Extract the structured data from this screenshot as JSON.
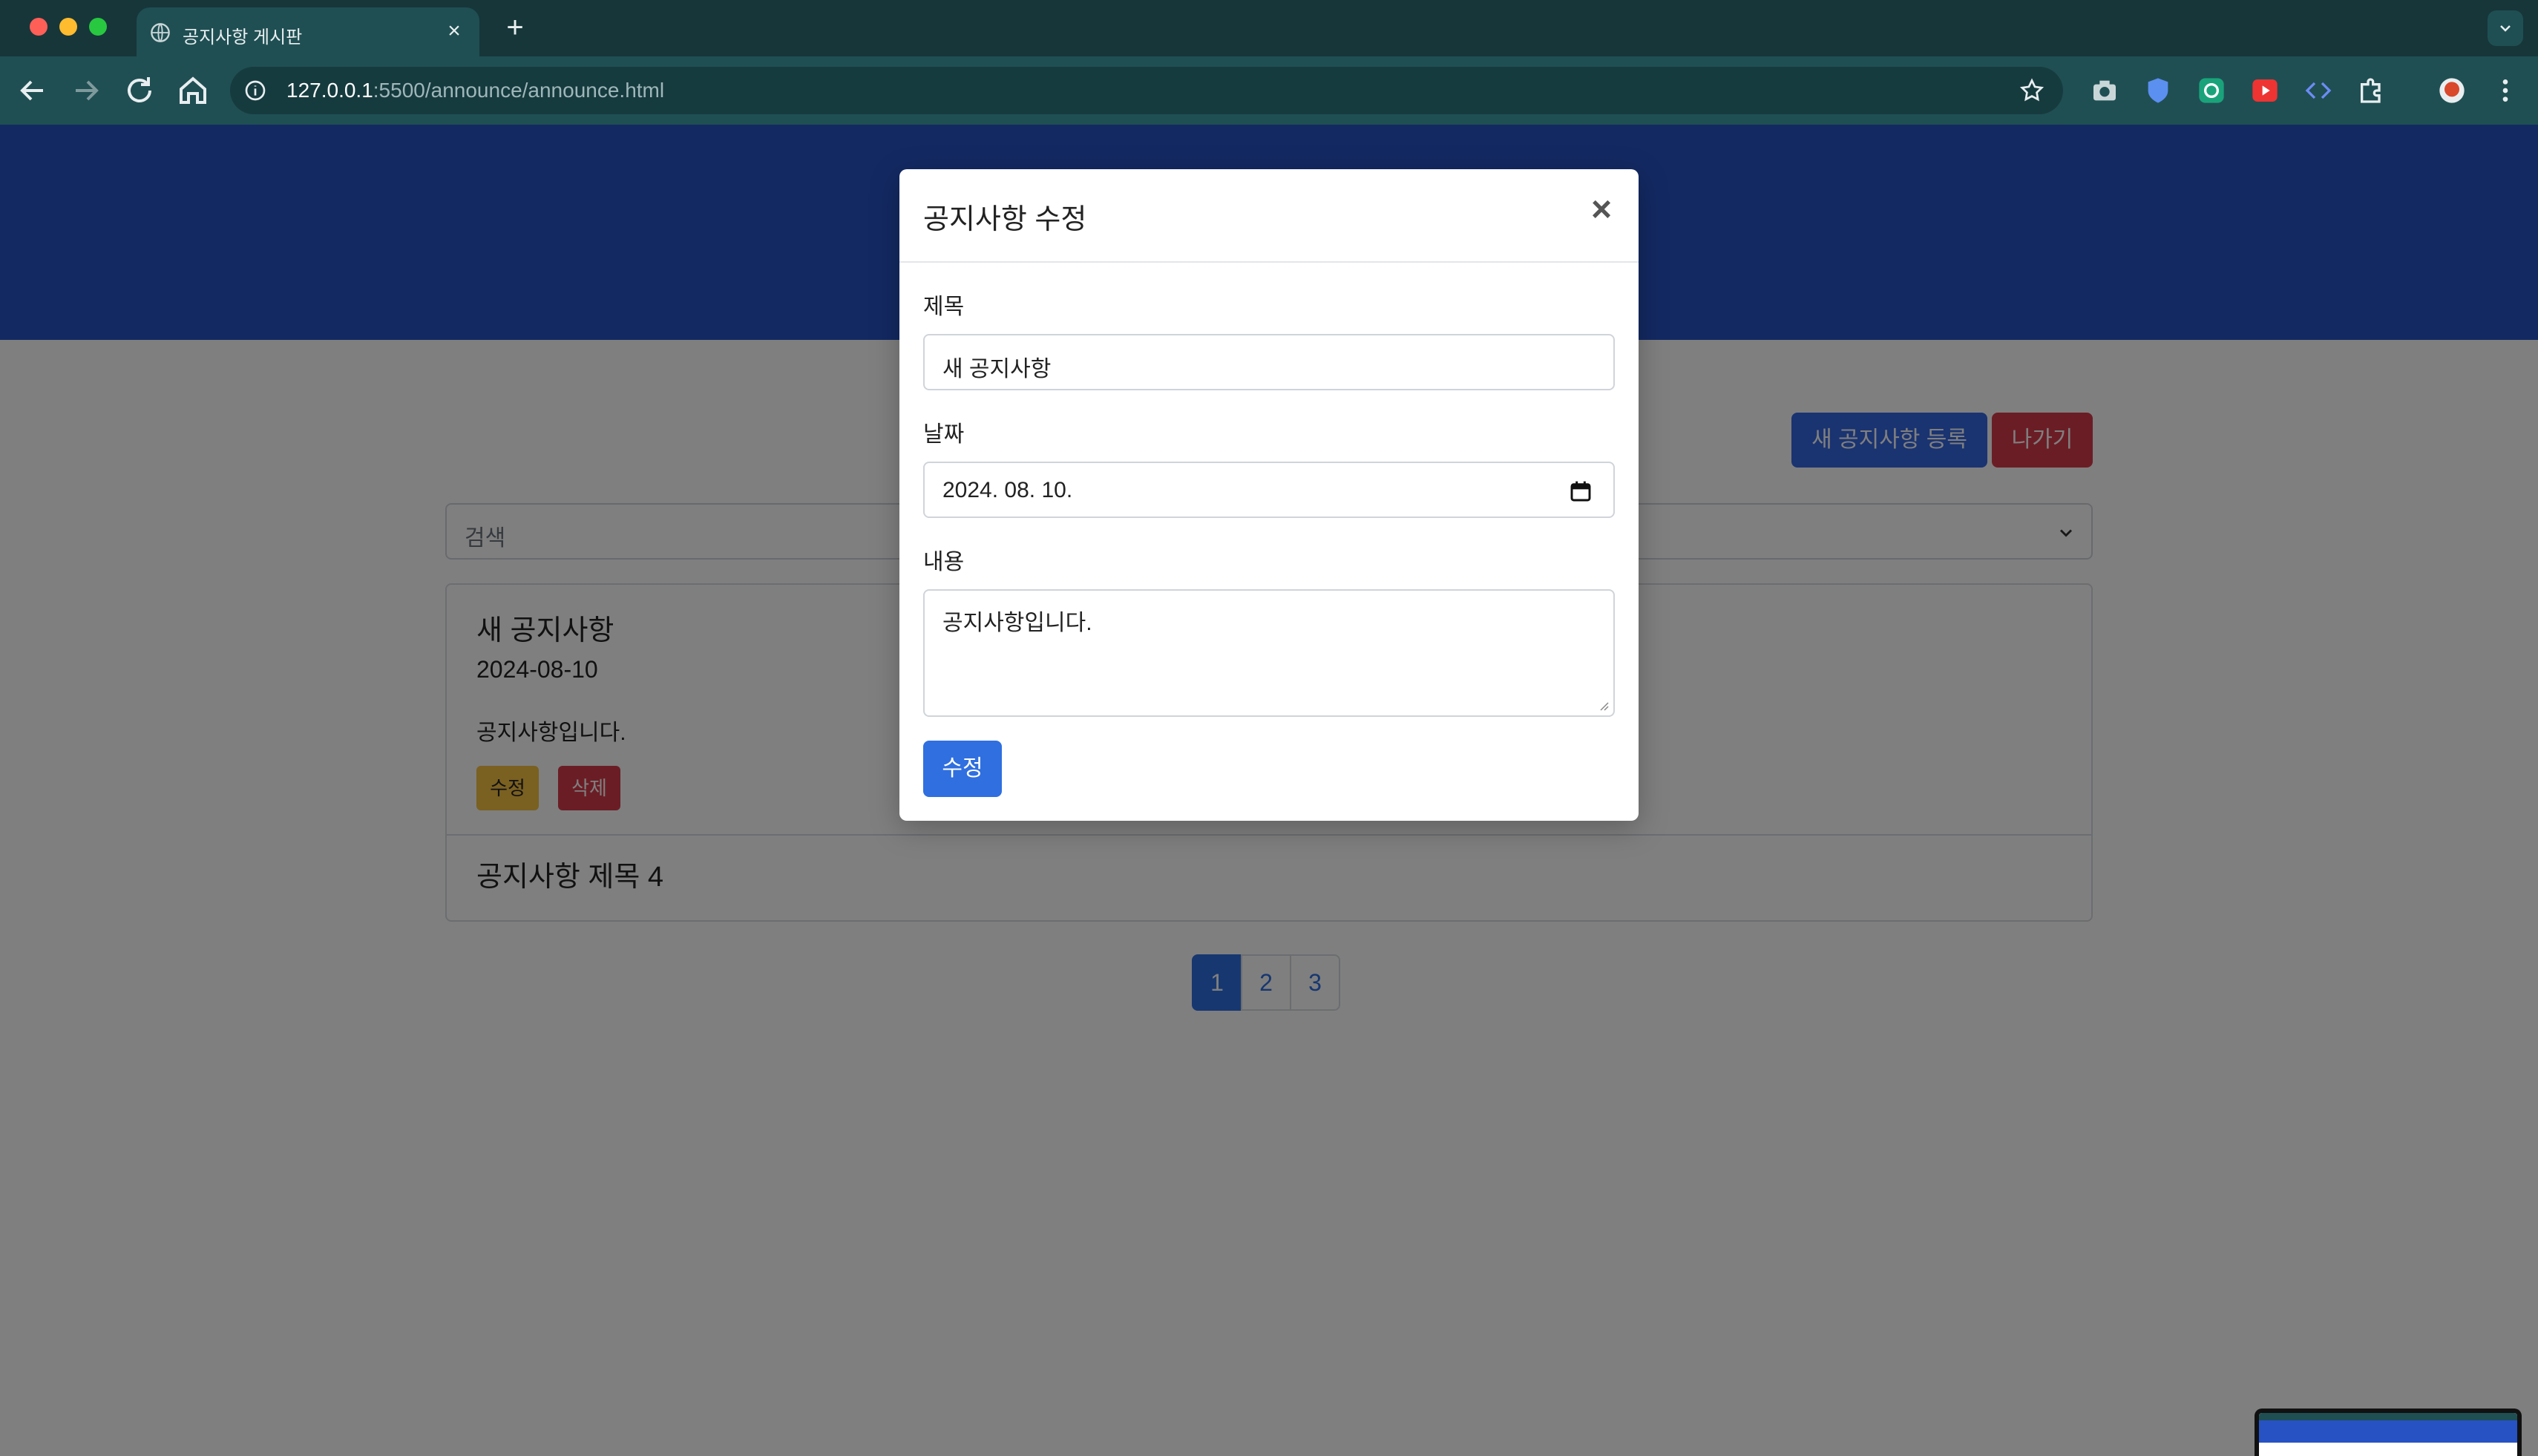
{
  "browser": {
    "tab_title": "공지사항 게시판",
    "url_host": "127.0.0.1",
    "url_rest": ":5500/announce/announce.html"
  },
  "page": {
    "new_button": "새 공지사항 등록",
    "exit_button": "나가기",
    "search_placeholder": "검색",
    "items": [
      {
        "title": "새 공지사항",
        "date": "2024-08-10",
        "content": "공지사항입니다.",
        "edit": "수정",
        "delete": "삭제"
      },
      {
        "title": "공지사항 제목 4"
      }
    ],
    "pages": [
      "1",
      "2",
      "3"
    ],
    "active_page": "1"
  },
  "modal": {
    "title": "공지사항 수정",
    "title_label": "제목",
    "title_value": "새 공지사항",
    "date_label": "날짜",
    "date_value": "2024. 08. 10.",
    "content_label": "내용",
    "content_value": "공지사항입니다.",
    "submit": "수정",
    "close": "×"
  },
  "colors": {
    "header_blue": "#2752c4",
    "primary": "#2f6fe0",
    "danger": "#d73a4a",
    "warning": "#f5c142",
    "chrome": "#1f4f53"
  }
}
